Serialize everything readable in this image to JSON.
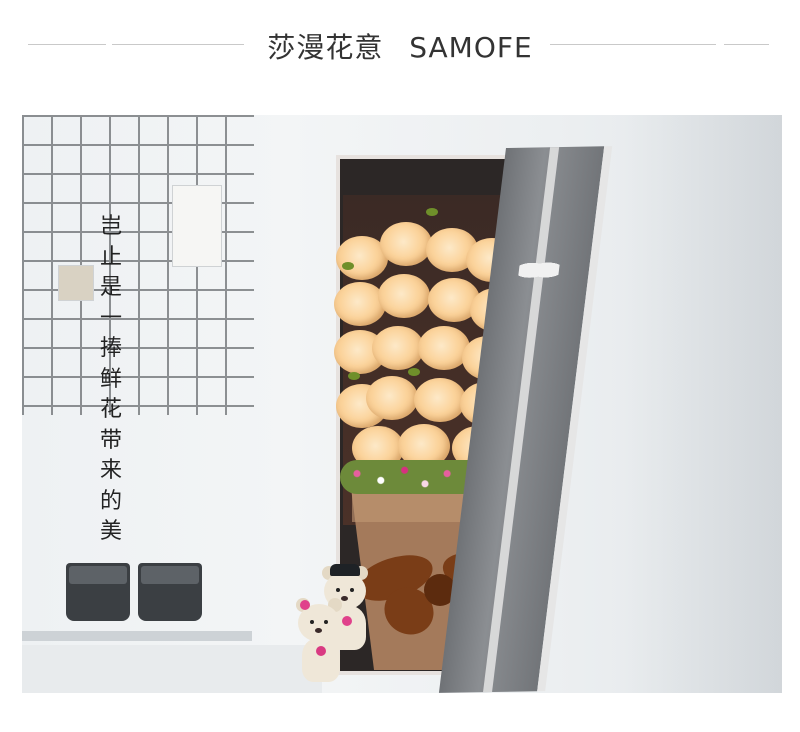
{
  "header": {
    "brand_cn": "莎漫花意",
    "brand_en": "SAMOFE"
  },
  "poem": {
    "characters": [
      "岂",
      "止",
      "是",
      "一",
      "捧",
      "鲜",
      "花",
      "带",
      "来",
      "的",
      "美"
    ]
  },
  "colors": {
    "rose": "#fbd39b",
    "box_lid": "#7d8084",
    "ribbon": "#7a3d17",
    "text": "#222222"
  }
}
